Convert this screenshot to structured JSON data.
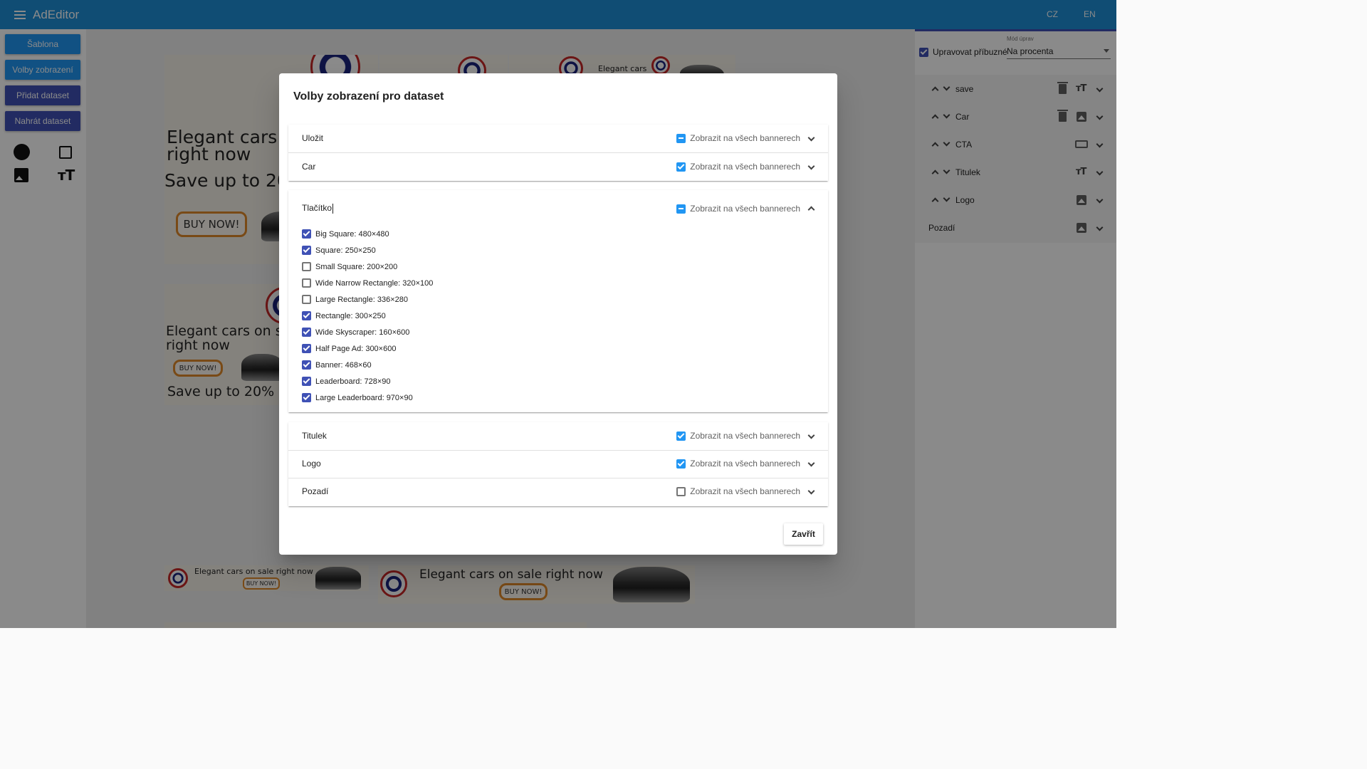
{
  "app": {
    "title": "AdEditor",
    "lang_cz": "CZ",
    "lang_en": "EN"
  },
  "left_panel": {
    "buttons": [
      "Šablona",
      "Volby zobrazení",
      "Přidat dataset",
      "Nahrát dataset"
    ],
    "tools": [
      "circle-icon",
      "square-icon",
      "image-icon",
      "text-size-icon"
    ]
  },
  "banners": {
    "headline": "Elegant cars",
    "headline2": "right now",
    "headline_full": "Elegant cars on s",
    "offer": "Save up to 20",
    "offer2": "Save up to 20%",
    "cta": "BUY NOW!",
    "leaderboard_text": "Elegant cars on sale right now",
    "small_text": "Elegant cars"
  },
  "right_panel": {
    "related_label": "Upravovat příbuzné",
    "related_checked": true,
    "mode_label": "Mód úprav",
    "mode_value": "Na procenta",
    "layers": [
      {
        "name": "save",
        "icons": [
          "trash-icon",
          "text-size-icon"
        ]
      },
      {
        "name": "Car",
        "icons": [
          "trash-icon",
          "image-icon"
        ]
      },
      {
        "name": "CTA",
        "icons": [
          "button-icon"
        ]
      },
      {
        "name": "Titulek",
        "icons": [
          "text-size-icon"
        ]
      },
      {
        "name": "Logo",
        "icons": [
          "image-icon"
        ]
      },
      {
        "name": "Pozadí",
        "icons": [
          "image-icon"
        ]
      }
    ]
  },
  "dialog": {
    "title": "Volby zobrazení pro dataset",
    "show_all_label": "Zobrazit na všech bannerech",
    "close_label": "Zavřít",
    "sections_top": [
      {
        "name": "Uložit",
        "state": "indeterminate"
      },
      {
        "name": "Car",
        "state": "checked"
      }
    ],
    "expanded": {
      "name": "Tlačítko",
      "state": "indeterminate",
      "sizes": [
        {
          "label": "Big Square: 480×480",
          "checked": true
        },
        {
          "label": "Square: 250×250",
          "checked": true
        },
        {
          "label": "Small Square: 200×200",
          "checked": false
        },
        {
          "label": "Wide Narrow Rectangle: 320×100",
          "checked": false
        },
        {
          "label": "Large Rectangle: 336×280",
          "checked": false
        },
        {
          "label": "Rectangle: 300×250",
          "checked": true
        },
        {
          "label": "Wide Skyscraper: 160×600",
          "checked": true
        },
        {
          "label": "Half Page Ad: 300×600",
          "checked": true
        },
        {
          "label": "Banner: 468×60",
          "checked": true
        },
        {
          "label": "Leaderboard: 728×90",
          "checked": true
        },
        {
          "label": "Large Leaderboard: 970×90",
          "checked": true
        }
      ]
    },
    "sections_bottom": [
      {
        "name": "Titulek",
        "state": "checked"
      },
      {
        "name": "Logo",
        "state": "checked"
      },
      {
        "name": "Pozadí",
        "state": "unchecked"
      }
    ]
  },
  "colors": {
    "appbar": "#1f8fd6",
    "primary": "#2196f3",
    "indigo": "#3f51b5"
  }
}
